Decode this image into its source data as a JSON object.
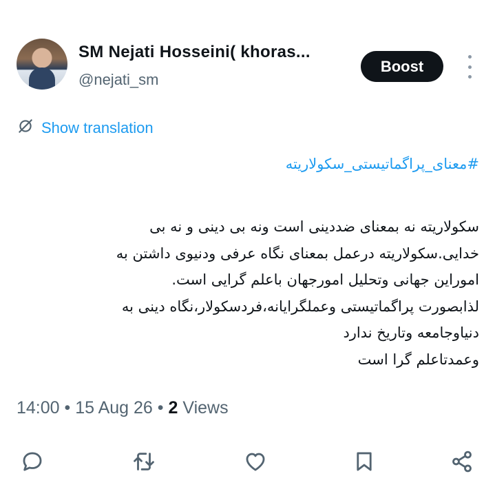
{
  "user": {
    "display_name": "SM Nejati Hosseini( khoras...",
    "handle": "@nejati_sm",
    "avatar_icon": "profile-photo"
  },
  "header": {
    "boost_label": "Boost",
    "more_icon": "more-vertical-icon"
  },
  "translation": {
    "label": "Show translation",
    "icon": "translate-icon"
  },
  "tweet": {
    "hashtag": "#معنای_پراگماتیستی_سکولاریته",
    "lines": [
      "سکولاریته نه بمعنای ضددینی است ونه بی دینی و نه بی",
      "خدایی.سکولاریته درعمل بمعنای نگاه عرفی ودنیوی داشتن به",
      "اموراین جهانی وتحلیل امورجهان باعلم گرایی است.",
      "لذابصورت پراگماتیستی وعملگرایانه،فردسکولار،نگاه دینی به",
      "دنیاوجامعه وتاریخ ندارد",
      "وعمدتاعلم گرا است"
    ]
  },
  "meta": {
    "time": "14:00",
    "separator": " • ",
    "date": "15 Aug 26",
    "views_count": "2",
    "views_label": " Views"
  },
  "actions": [
    "reply-icon",
    "retweet-icon",
    "like-icon",
    "bookmark-icon",
    "share-icon"
  ],
  "colors": {
    "accent": "#1d9bf0",
    "text": "#0f1419",
    "secondary": "#536471",
    "boost_bg": "#0f1419"
  }
}
